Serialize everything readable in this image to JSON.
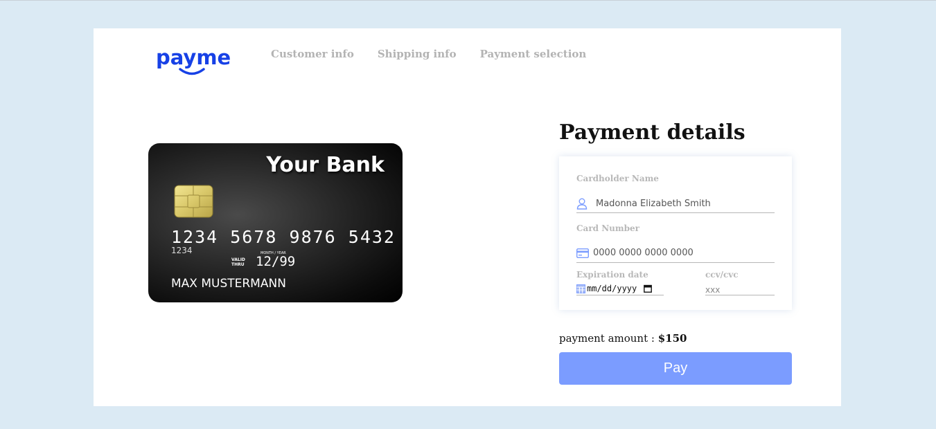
{
  "brand": {
    "name": "payme",
    "color": "#1741e6"
  },
  "nav": {
    "items": [
      {
        "label": "Customer info"
      },
      {
        "label": "Shipping info"
      },
      {
        "label": "Payment selection"
      }
    ]
  },
  "card": {
    "bank_name": "Your Bank",
    "number": "1234 5678 9876 5432",
    "number_short": "1234",
    "valid_thru_label": "VALID THRU",
    "month_year_label": "MONTH / YEAR",
    "expiry": "12/99",
    "holder_name": "MAX MUSTERMANN"
  },
  "form": {
    "title": "Payment details",
    "cardholder": {
      "label": "Cardholder Name",
      "placeholder": "Madonna Elizabeth Smith",
      "icon": "user-icon"
    },
    "card_number": {
      "label": "Card Number",
      "placeholder": "0000 0000 0000 0000",
      "icon": "credit-card-icon"
    },
    "expiration": {
      "label": "Expiration date",
      "placeholder": "mm/dd/yyyy",
      "icon": "calendar-icon"
    },
    "cvc": {
      "label": "ccv/cvc",
      "placeholder": "xxx"
    }
  },
  "payment": {
    "label": "payment amount :",
    "amount": "$150",
    "button_label": "Pay",
    "button_color": "#7b9cff"
  },
  "colors": {
    "background": "#dbeaf4",
    "accent_icon": "#7b9cff"
  }
}
